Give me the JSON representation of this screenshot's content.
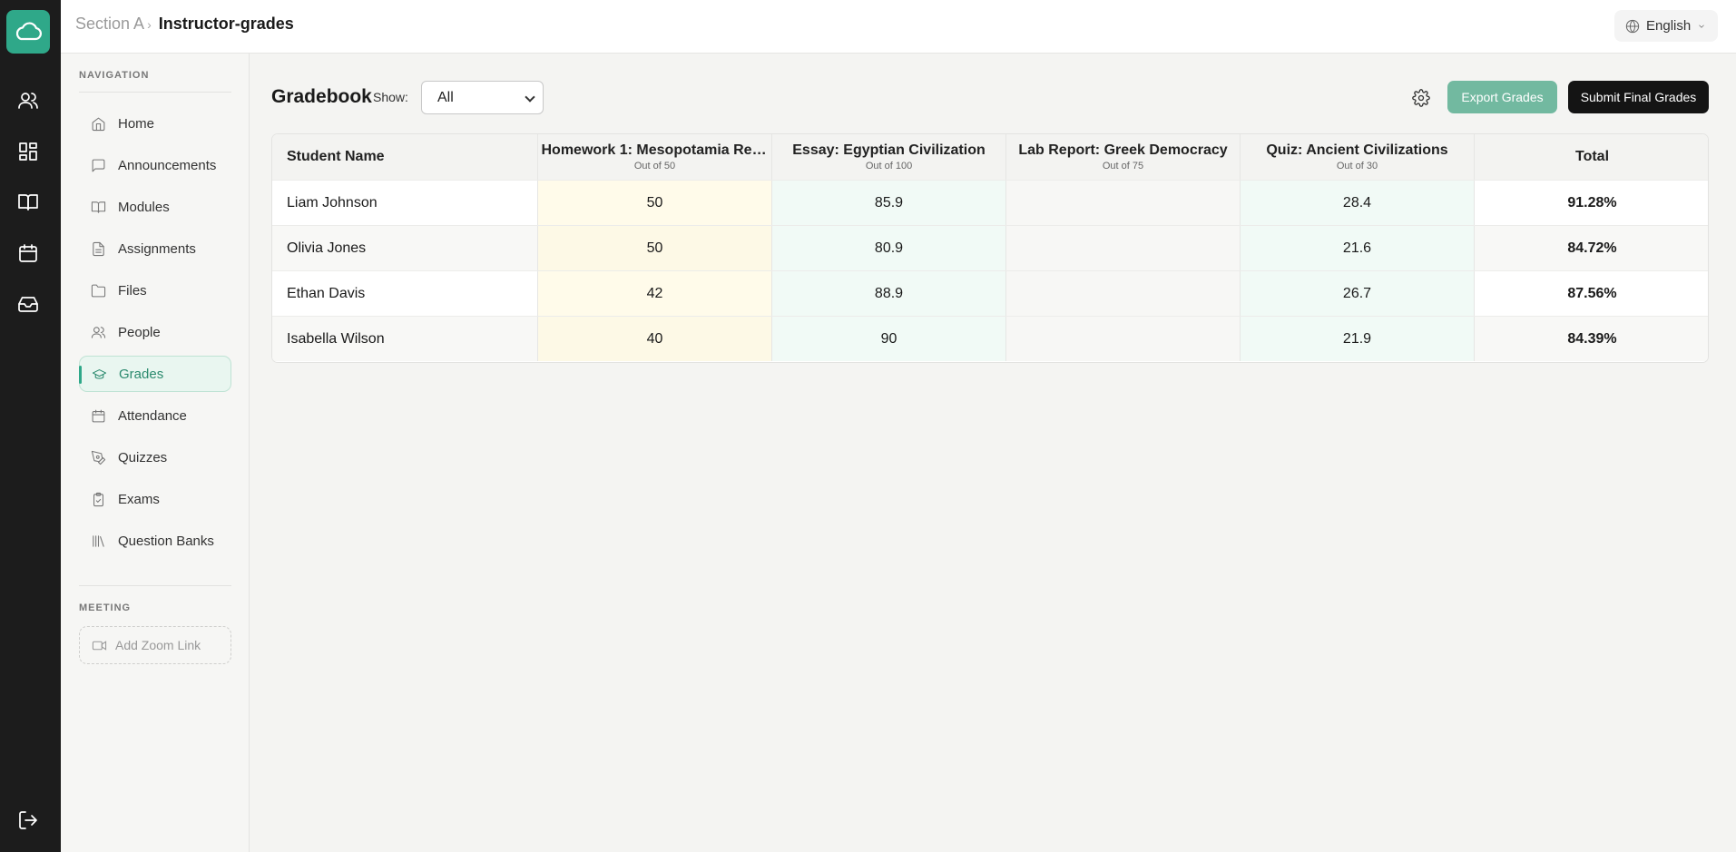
{
  "breadcrumb": {
    "parent": "Section A",
    "current": "Instructor-grades"
  },
  "language": {
    "label": "English"
  },
  "sidebar": {
    "navigation_header": "NAVIGATION",
    "items": [
      {
        "label": "Home",
        "icon": "home-icon"
      },
      {
        "label": "Announcements",
        "icon": "message-icon"
      },
      {
        "label": "Modules",
        "icon": "book-icon"
      },
      {
        "label": "Assignments",
        "icon": "file-icon"
      },
      {
        "label": "Files",
        "icon": "folder-icon"
      },
      {
        "label": "People",
        "icon": "users-icon"
      },
      {
        "label": "Grades",
        "icon": "graduation-cap-icon",
        "active": true
      },
      {
        "label": "Attendance",
        "icon": "calendar-icon"
      },
      {
        "label": "Quizzes",
        "icon": "pen-icon"
      },
      {
        "label": "Exams",
        "icon": "clipboard-icon"
      },
      {
        "label": "Question Banks",
        "icon": "library-icon"
      }
    ],
    "meeting_header": "MEETING",
    "add_zoom_label": "Add Zoom Link"
  },
  "gradebook": {
    "title": "Gradebook",
    "show_label": "Show:",
    "show_value": "All",
    "export_label": "Export Grades",
    "submit_label": "Submit Final Grades",
    "columns": [
      {
        "title": "Student Name",
        "sub": ""
      },
      {
        "title": "Homework 1: Mesopotamia Rese...",
        "sub": "Out of 50"
      },
      {
        "title": "Essay: Egyptian Civilization",
        "sub": "Out of 100"
      },
      {
        "title": "Lab Report: Greek Democracy",
        "sub": "Out of 75"
      },
      {
        "title": "Quiz: Ancient Civilizations",
        "sub": "Out of 30"
      },
      {
        "title": "Total",
        "sub": ""
      }
    ],
    "rows": [
      {
        "name": "Liam Johnson",
        "hw": "50",
        "essay": "85.9",
        "lab": "",
        "quiz": "28.4",
        "total": "91.28%"
      },
      {
        "name": "Olivia Jones",
        "hw": "50",
        "essay": "80.9",
        "lab": "",
        "quiz": "21.6",
        "total": "84.72%"
      },
      {
        "name": "Ethan Davis",
        "hw": "42",
        "essay": "88.9",
        "lab": "",
        "quiz": "26.7",
        "total": "87.56%"
      },
      {
        "name": "Isabella Wilson",
        "hw": "40",
        "essay": "90",
        "lab": "",
        "quiz": "21.9",
        "total": "84.39%"
      }
    ]
  },
  "colors": {
    "accent": "#2fa889",
    "export_button": "#72b9a0",
    "submit_button": "#141414",
    "rail": "#1c1c1c"
  }
}
